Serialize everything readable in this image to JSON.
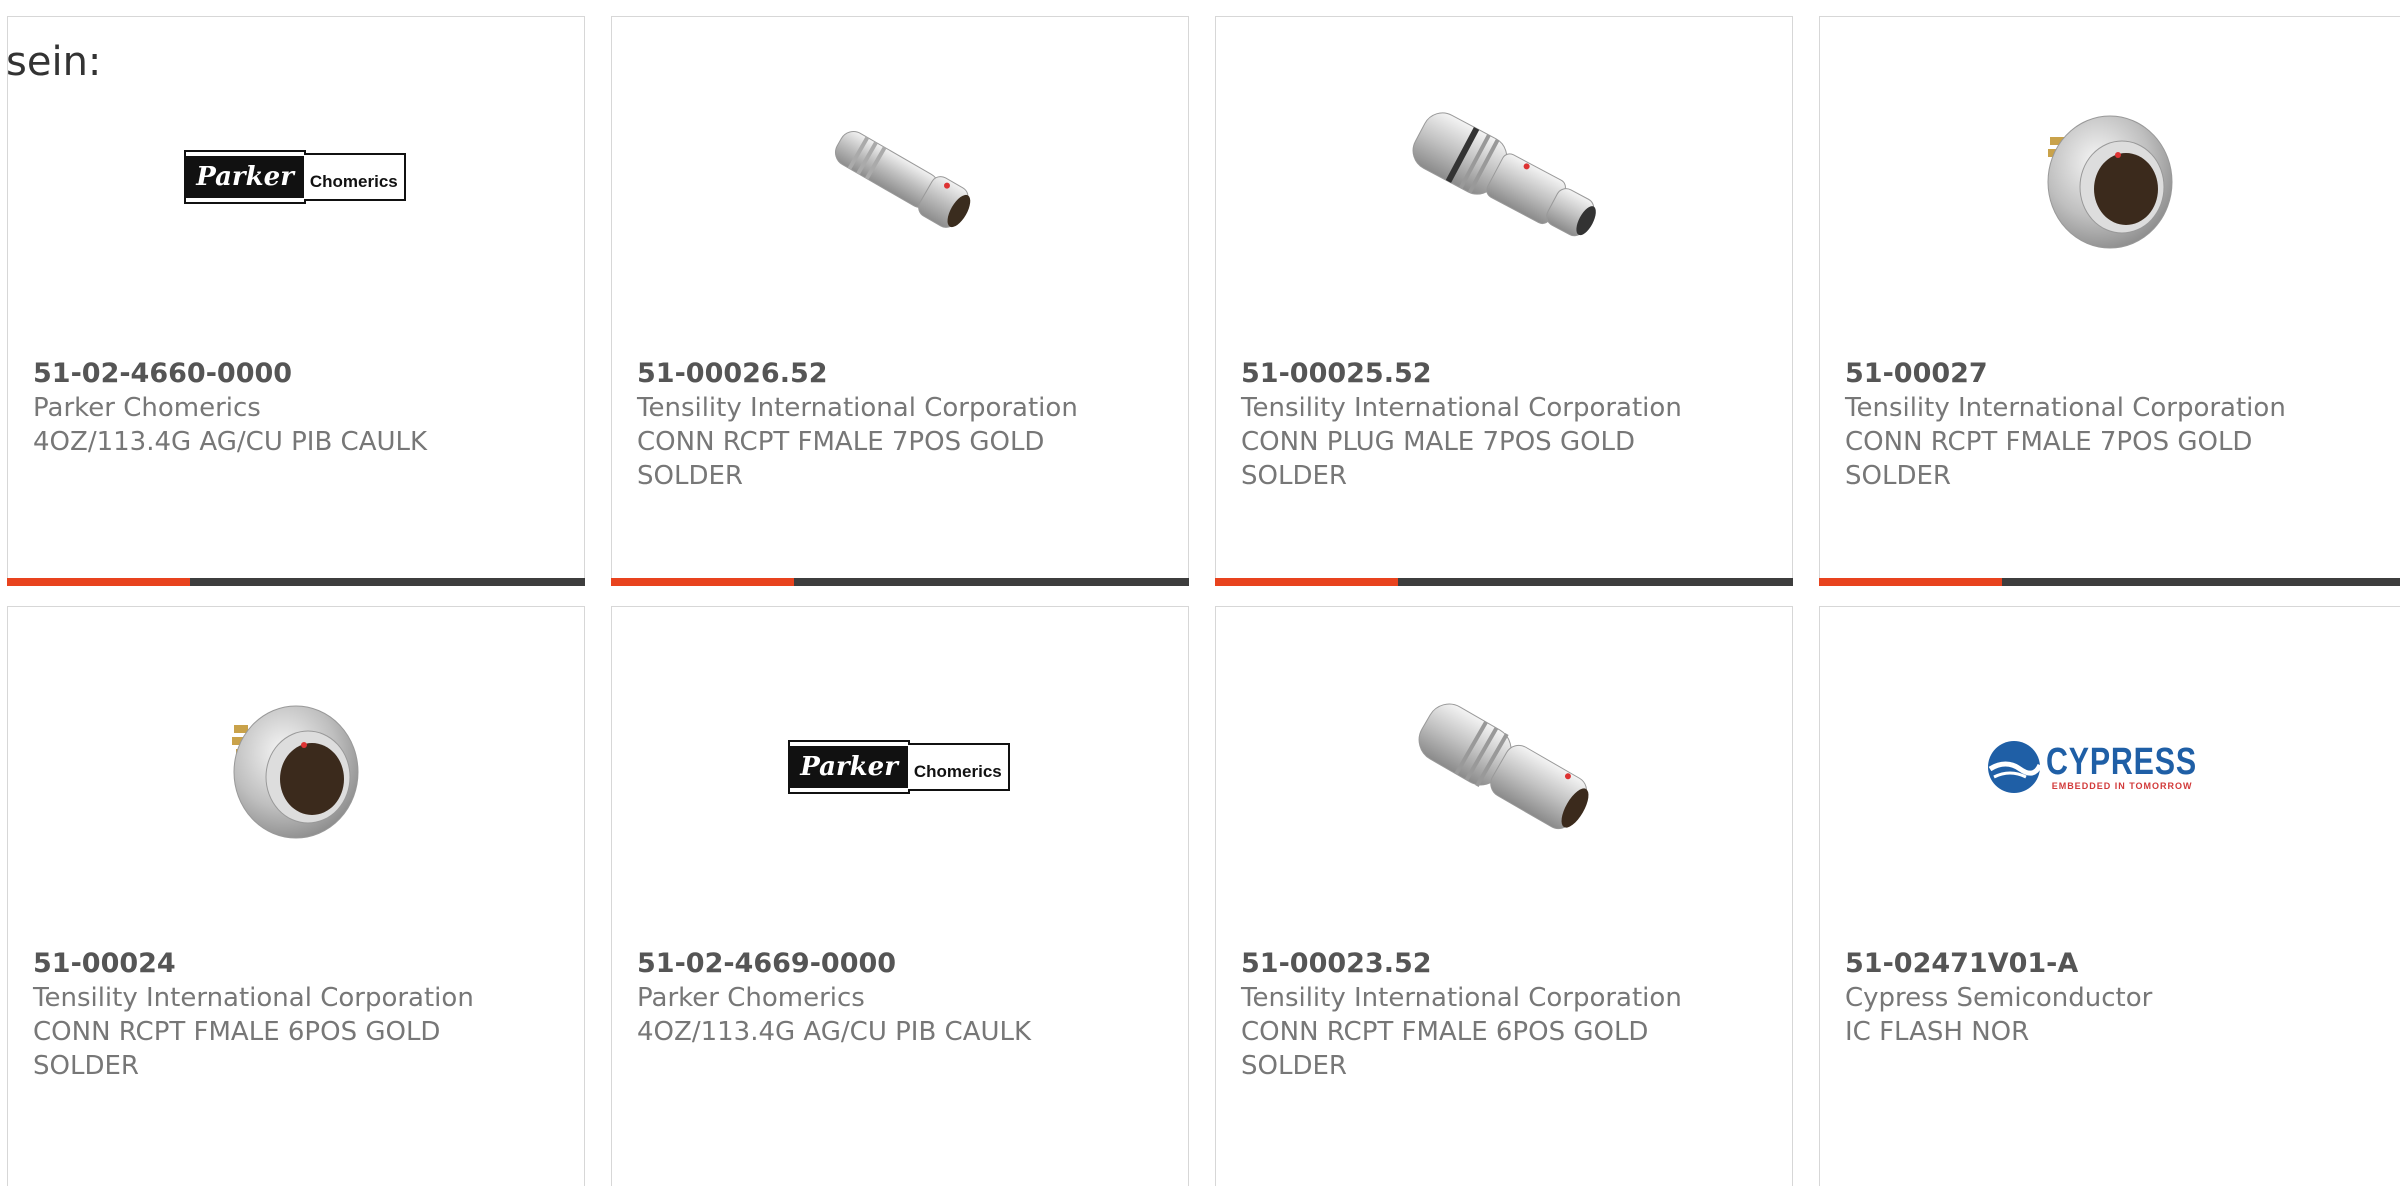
{
  "intro_text": "sein:",
  "logos": {
    "parker": {
      "main": "Parker",
      "sub": "Chomerics"
    },
    "cypress": {
      "main": "CYPRESS",
      "tagline": "EMBEDDED IN TOMORROW"
    }
  },
  "colors": {
    "accent": "#e8431e",
    "bar_dark": "#3d3d3d",
    "card_border": "#d7d7d7"
  },
  "products": [
    {
      "part_number": "51-02-4660-0000",
      "manufacturer": "Parker Chomerics",
      "description": "4OZ/113.4G AG/CU PIB CAULK",
      "description_2": "",
      "image": "parker-logo"
    },
    {
      "part_number": "51-00026.52",
      "manufacturer": "Tensility International Corporation",
      "description": "CONN RCPT FMALE 7POS GOLD",
      "description_2": "SOLDER",
      "image": "connector-plug-small"
    },
    {
      "part_number": "51-00025.52",
      "manufacturer": "Tensility International Corporation",
      "description": "CONN PLUG MALE 7POS GOLD",
      "description_2": "SOLDER",
      "image": "connector-plug-large"
    },
    {
      "part_number": "51-00027",
      "manufacturer": "Tensility International Corporation",
      "description": "CONN RCPT FMALE 7POS GOLD",
      "description_2": "SOLDER",
      "image": "connector-receptacle"
    },
    {
      "part_number": "51-00024",
      "manufacturer": "Tensility International Corporation",
      "description": "CONN RCPT FMALE 6POS GOLD",
      "description_2": "SOLDER",
      "image": "connector-receptacle"
    },
    {
      "part_number": "51-02-4669-0000",
      "manufacturer": "Parker Chomerics",
      "description": "4OZ/113.4G AG/CU PIB CAULK",
      "description_2": "",
      "image": "parker-logo"
    },
    {
      "part_number": "51-00023.52",
      "manufacturer": "Tensility International Corporation",
      "description": "CONN RCPT FMALE 6POS GOLD",
      "description_2": "SOLDER",
      "image": "connector-plug-large"
    },
    {
      "part_number": "51-02471V01-A",
      "manufacturer": "Cypress Semiconductor",
      "description": "IC FLASH NOR",
      "description_2": "",
      "image": "cypress-logo"
    }
  ]
}
